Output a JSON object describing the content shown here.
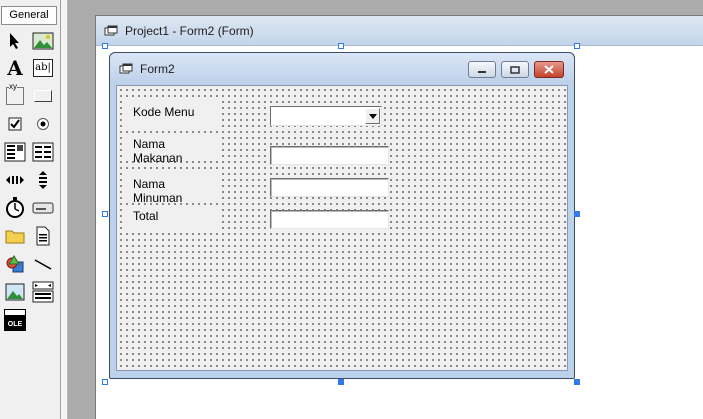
{
  "toolbox": {
    "tab_label": "General",
    "tools": [
      {
        "name": "pointer-icon"
      },
      {
        "name": "picturebox-icon"
      },
      {
        "name": "label-icon",
        "glyph": "A"
      },
      {
        "name": "textbox-icon",
        "glyph": "ab|"
      },
      {
        "name": "frame-icon",
        "glyph": "xy"
      },
      {
        "name": "commandbutton-icon"
      },
      {
        "name": "checkbox-icon"
      },
      {
        "name": "optionbutton-icon"
      },
      {
        "name": "combobox-icon"
      },
      {
        "name": "listbox-icon"
      },
      {
        "name": "hscrollbar-icon"
      },
      {
        "name": "vscrollbar-icon"
      },
      {
        "name": "timer-icon"
      },
      {
        "name": "drivelistbox-icon"
      },
      {
        "name": "dirlistbox-icon"
      },
      {
        "name": "filelistbox-icon"
      },
      {
        "name": "shape-icon"
      },
      {
        "name": "line-icon"
      },
      {
        "name": "image-icon"
      },
      {
        "name": "data-icon"
      },
      {
        "name": "ole-icon",
        "glyph": "OLE"
      }
    ]
  },
  "designer": {
    "title": "Project1 - Form2 (Form)"
  },
  "form": {
    "caption": "Form2",
    "labels": {
      "kode_menu": "Kode Menu",
      "nama_makanan": "Nama Makanan",
      "nama_minuman": "Nama Minuman",
      "total": "Total"
    },
    "inputs": {
      "kode_menu": "",
      "nama_makanan": "",
      "nama_minuman": "",
      "total": ""
    }
  },
  "colors": {
    "selection_handle": "#3079ed",
    "close_button": "#c5422d",
    "grid_dot": "#000000"
  }
}
